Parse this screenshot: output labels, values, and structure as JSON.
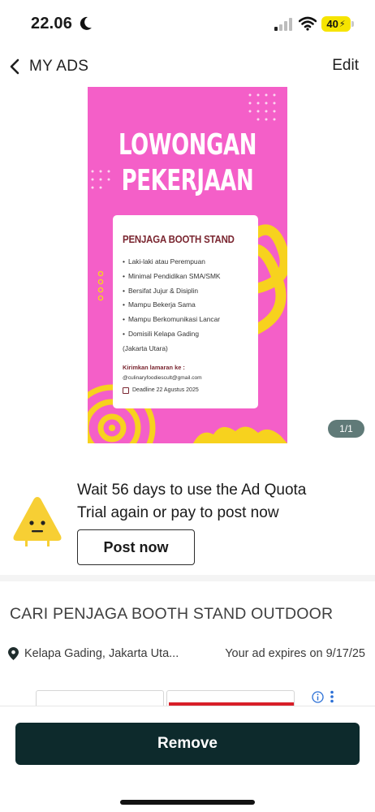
{
  "status_bar": {
    "time": "22.06",
    "battery": "40",
    "icons": [
      "moon-icon",
      "signal-icon",
      "wifi-icon",
      "battery-icon"
    ]
  },
  "nav": {
    "title": "MY ADS",
    "edit_label": "Edit",
    "back_icon": "chevron-left-icon"
  },
  "ad_image": {
    "heading_line1": "LOWONGAN",
    "heading_line2": "PEKERJAAN",
    "card_title": "PENJAGA BOOTH STAND",
    "requirements": [
      "Laki-laki atau Perempuan",
      "Minimal Pendidikan SMA/SMK",
      "Bersifat Jujur & Disiplin",
      "Mampu Bekerja Sama",
      "Mampu Berkomunikasi Lancar",
      "Domisili Kelapa Gading",
      "(Jakarta Utara)"
    ],
    "apply_label": "Kirimkan lamaran ke :",
    "email": "@culinaryfoodiescult@gmail.com",
    "deadline": "Deadline 22 Agustus 2025",
    "page_counter": "1/1",
    "colors": {
      "background": "#f45fc8",
      "accent_yellow": "#f7d21e",
      "title": "#7a2630"
    }
  },
  "quota": {
    "line1": "Wait 56 days to use the Ad Quota",
    "line2": "Trial again or pay to post now",
    "post_now_label": "Post now",
    "icon": "warning-triangle-face-icon"
  },
  "ad": {
    "title": "CARI PENJAGA BOOTH STAND OUTDOOR",
    "location": "Kelapa Gading, Jakarta Uta...",
    "expiry": "Your ad expires on 9/17/25"
  },
  "bottom": {
    "remove_label": "Remove",
    "button_color": "#0d2a2c"
  }
}
